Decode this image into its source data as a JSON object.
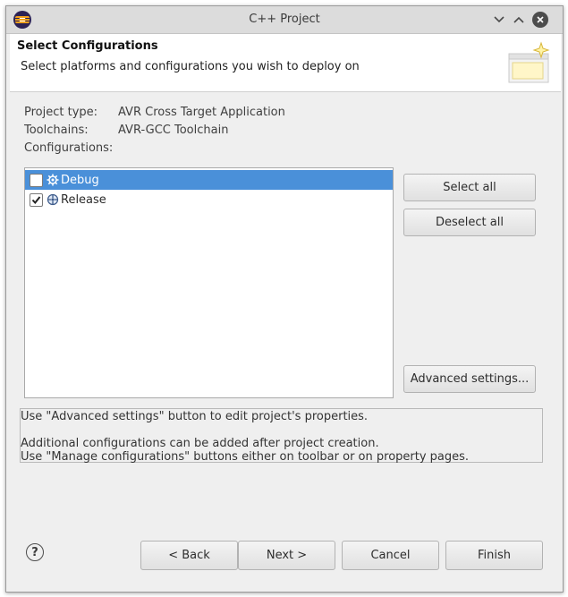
{
  "window": {
    "title": "C++ Project",
    "controls": [
      "minimize",
      "maximize",
      "close"
    ]
  },
  "header": {
    "title": "Select Configurations",
    "description": "Select platforms and configurations you wish to deploy on"
  },
  "info": {
    "project_type_label": "Project type:",
    "project_type_value": "AVR Cross Target Application",
    "toolchains_label": "Toolchains:",
    "toolchains_value": "AVR-GCC Toolchain",
    "configurations_label": "Configurations:"
  },
  "configurations": [
    {
      "label": "Debug",
      "checked": false,
      "selected": true,
      "icon": "debug-gear-icon"
    },
    {
      "label": "Release",
      "checked": true,
      "selected": false,
      "icon": "release-gear-icon"
    }
  ],
  "side_buttons": {
    "select_all": "Select all",
    "deselect_all": "Deselect all",
    "advanced_settings": "Advanced settings..."
  },
  "messages": {
    "line1": "Use \"Advanced settings\" button to edit project's properties.",
    "line2": "Additional configurations can be added after project creation.",
    "line3": "Use \"Manage configurations\" buttons either on toolbar or on property pages."
  },
  "footer": {
    "help_glyph": "?",
    "back": "< Back",
    "next": "Next >",
    "cancel": "Cancel",
    "finish": "Finish"
  },
  "colors": {
    "selection": "#4a90d9",
    "dialog_bg": "#efefef"
  }
}
